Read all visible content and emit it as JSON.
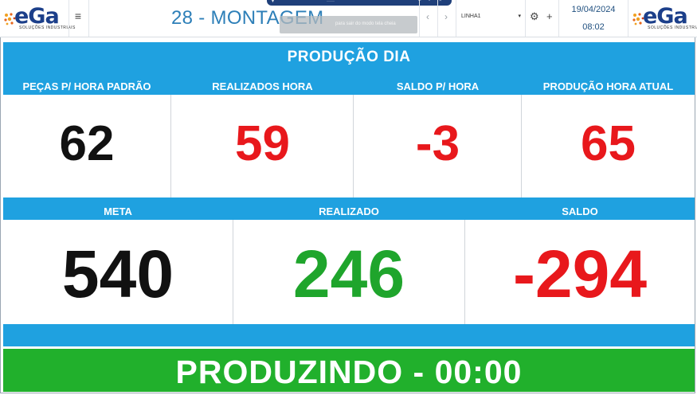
{
  "header": {
    "logo_text": "eGa",
    "logo_subtitle": "SOLUÇÕES INDUSTRIAIS",
    "page_title": "28 - MONTAGEM",
    "line_select": {
      "value": "LINHA1"
    },
    "date": "19/04/2024",
    "time": "08:02",
    "fullscreen_tip": "para sair do modo tela cheia"
  },
  "dashboard": {
    "title": "PRODUÇÃO DIA",
    "hour_metrics": [
      {
        "label": "PEÇAS P/ HORA PADRÃO",
        "value": "62",
        "color": "#111111"
      },
      {
        "label": "REALIZADOS HORA",
        "value": "59",
        "color": "#e8181c"
      },
      {
        "label": "SALDO P/ HORA",
        "value": "-3",
        "color": "#e8181c"
      },
      {
        "label": "PRODUÇÃO HORA ATUAL",
        "value": "65",
        "color": "#e8181c"
      }
    ],
    "day_metrics": [
      {
        "label": "META",
        "value": "540",
        "color": "#111111"
      },
      {
        "label": "REALIZADO",
        "value": "246",
        "color": "#1fa52c"
      },
      {
        "label": "SALDO",
        "value": "-294",
        "color": "#e8181c"
      }
    ],
    "status": "PRODUZINDO - 00:00"
  },
  "colors": {
    "panel_blue": "#1fa1e0",
    "status_green": "#21b02c",
    "title_blue": "#2d7fb8"
  },
  "icons": [
    "menu-icon",
    "prev-arrow-icon",
    "next-arrow-icon",
    "dropdown-caret-icon",
    "settings-icon",
    "plus-icon"
  ]
}
